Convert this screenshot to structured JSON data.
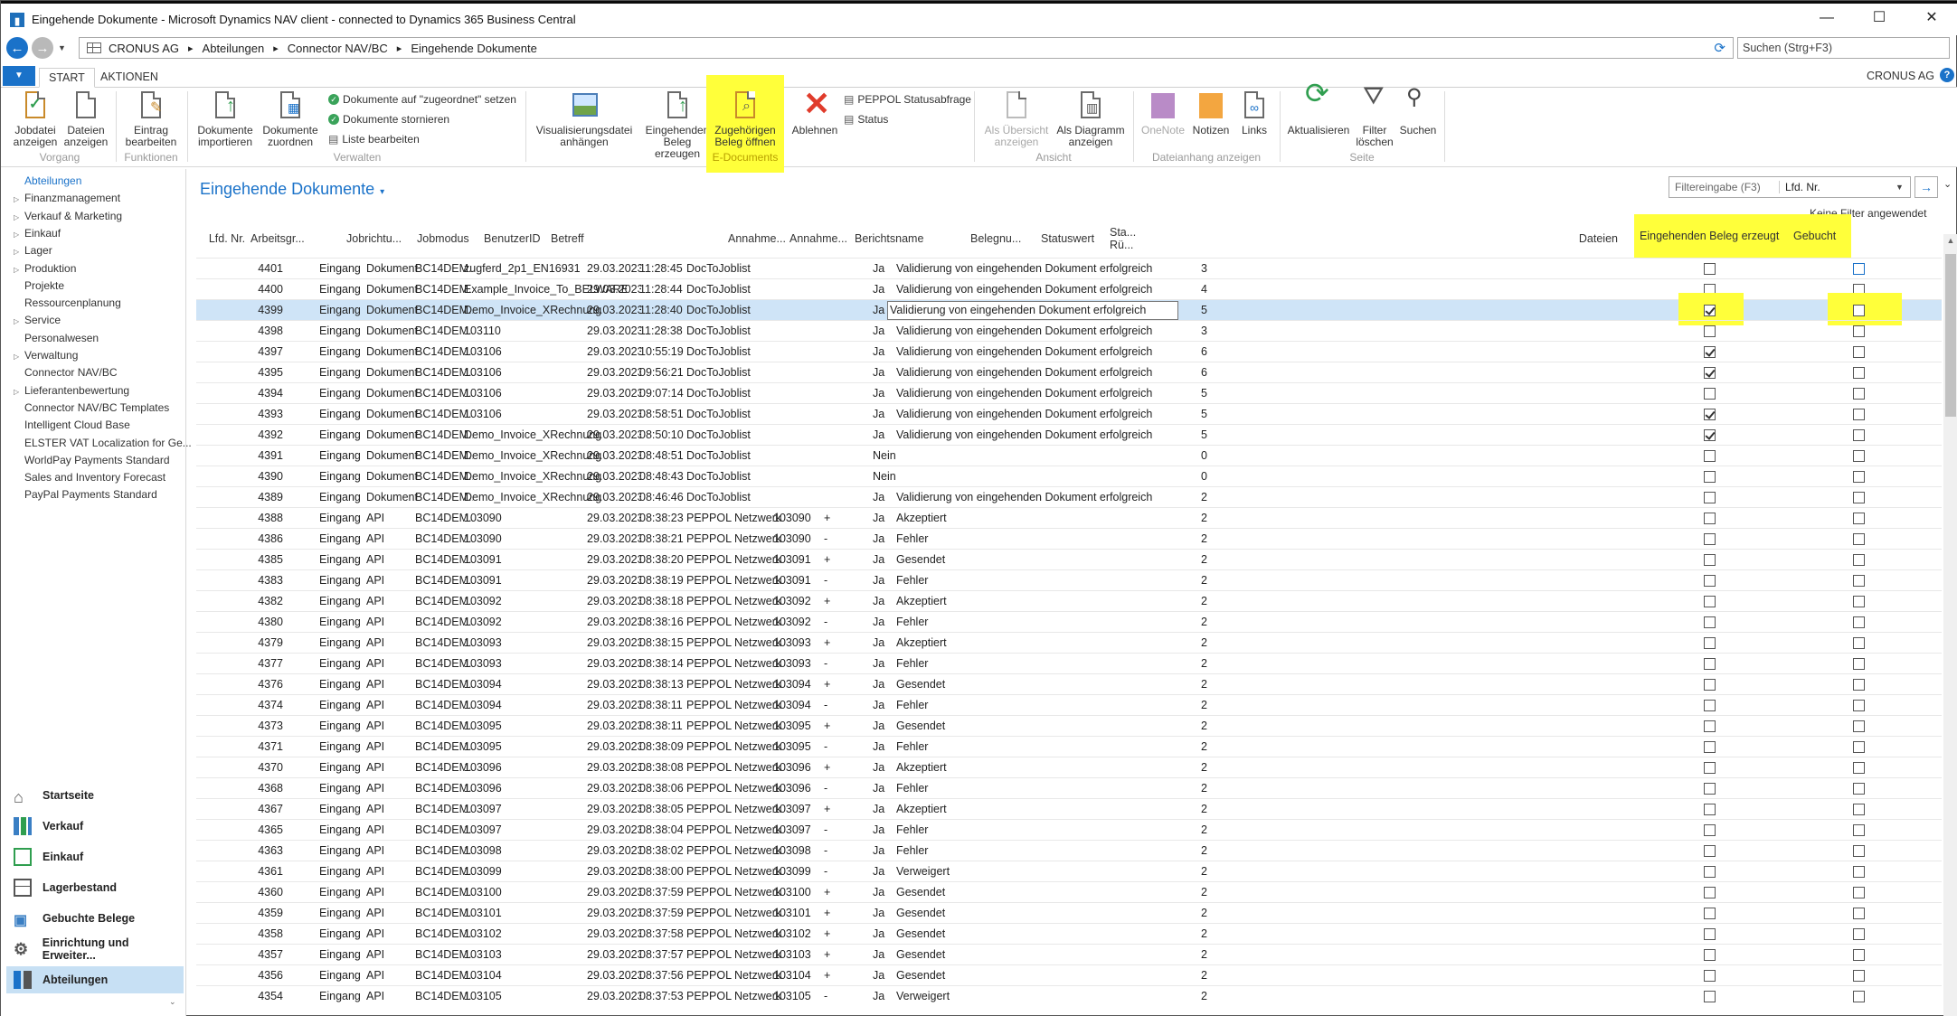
{
  "window": {
    "title": "Eingehende Dokumente - Microsoft Dynamics NAV client - connected to Dynamics 365 Business Central",
    "minimize": "—",
    "maximize": "☐",
    "close": "✕"
  },
  "nav": {
    "crumbs": [
      "CRONUS AG",
      "Abteilungen",
      "Connector NAV/BC",
      "Eingehende Dokumente"
    ],
    "search_placeholder": "Suchen (Strg+F3)"
  },
  "tabs": {
    "start": "START",
    "aktionen": "AKTIONEN"
  },
  "company": "CRONUS AG",
  "help": "?",
  "ribbon": {
    "buttons": {
      "jobdatei": "Jobdatei anzeigen",
      "dateien": "Dateien anzeigen",
      "eintrag": "Eintrag bearbeiten",
      "importieren": "Dokumente importieren",
      "zuordnen": "Dokumente zuordnen",
      "set_zugeordnet": "Dokumente auf \"zugeordnet\" setzen",
      "stornieren": "Dokumente stornieren",
      "liste": "Liste bearbeiten",
      "visualisierung": "Visualisierungsdatei anhängen",
      "beleg_erzeugen": "Eingehenden Beleg erzeugen",
      "beleg_oeffnen": "Zugehörigen Beleg öffnen",
      "ablehnen": "Ablehnen",
      "peppol": "PEPPOL Statusabfrage",
      "status": "Status",
      "als_uebersicht": "Als Übersicht anzeigen",
      "als_diagramm": "Als Diagramm anzeigen",
      "onenote": "OneNote",
      "notizen": "Notizen",
      "links": "Links",
      "aktualisieren": "Aktualisieren",
      "filter_loeschen": "Filter löschen",
      "suchen": "Suchen"
    },
    "groups": {
      "vorgang": "Vorgang",
      "funktionen": "Funktionen",
      "verwalten": "Verwalten",
      "edocuments": "E-Documents",
      "ansicht": "Ansicht",
      "dateianhang": "Dateianhang anzeigen",
      "seite": "Seite"
    }
  },
  "leftnav": {
    "items": [
      {
        "label": "Abteilungen",
        "tri": ""
      },
      {
        "label": "Finanzmanagement",
        "tri": "▷"
      },
      {
        "label": "Verkauf & Marketing",
        "tri": "▷"
      },
      {
        "label": "Einkauf",
        "tri": "▷"
      },
      {
        "label": "Lager",
        "tri": "▷"
      },
      {
        "label": "Produktion",
        "tri": "▷"
      },
      {
        "label": "Projekte",
        "tri": ""
      },
      {
        "label": "Ressourcenplanung",
        "tri": ""
      },
      {
        "label": "Service",
        "tri": "▷"
      },
      {
        "label": "Personalwesen",
        "tri": ""
      },
      {
        "label": "Verwaltung",
        "tri": "▷"
      },
      {
        "label": "Connector NAV/BC",
        "tri": ""
      },
      {
        "label": "Lieferantenbewertung",
        "tri": "▷"
      },
      {
        "label": "Connector NAV/BC Templates",
        "tri": ""
      },
      {
        "label": "Intelligent Cloud Base",
        "tri": ""
      },
      {
        "label": "ELSTER VAT Localization for Ge...",
        "tri": ""
      },
      {
        "label": "WorldPay Payments Standard",
        "tri": ""
      },
      {
        "label": "Sales and Inventory Forecast",
        "tri": ""
      },
      {
        "label": "PayPal Payments Standard",
        "tri": ""
      }
    ],
    "bottom": [
      {
        "label": "Startseite",
        "icon": "home-icon"
      },
      {
        "label": "Verkauf",
        "icon": "sales-icon"
      },
      {
        "label": "Einkauf",
        "icon": "purchase-icon"
      },
      {
        "label": "Lagerbestand",
        "icon": "inventory-icon"
      },
      {
        "label": "Gebuchte Belege",
        "icon": "posted-docs-icon"
      },
      {
        "label": "Einrichtung und Erweiter...",
        "icon": "settings-icon"
      },
      {
        "label": "Abteilungen",
        "icon": "departments-icon"
      }
    ]
  },
  "page": {
    "title": "Eingehende Dokumente",
    "title_caret": "▾",
    "filter_placeholder": "Filtereingabe (F3)",
    "filter_field": "Lfd. Nr.",
    "no_filter": "Keine Filter angewendet"
  },
  "columns": [
    "Lfd. Nr.",
    "Arbeitsgr...",
    "Jobrichtu...",
    "Jobmodus",
    "BenutzerID",
    "Betreff",
    "Annahme...",
    "Annahme...",
    "Berichtsname",
    "Belegnu...",
    "Statuswert",
    "Sta... Rü...",
    "",
    "Dateien",
    "Eingehenden Beleg erzeugt",
    "Gebucht"
  ],
  "rows": [
    {
      "nr": "4401",
      "job": "Eingang",
      "mode": "Dokument",
      "user": "BC14DEM...",
      "betreff": "zugferd_2p1_EN16931",
      "date": "29.03.2023",
      "time": "11:28:45",
      "report": "DocToJoblist",
      "beleg": "",
      "sw": "",
      "ru": "Ja",
      "msg": "Validierung von eingehenden Dokument erfolgreich",
      "files": "3",
      "created": false,
      "posted": false
    },
    {
      "nr": "4400",
      "job": "Eingang",
      "mode": "Dokument",
      "user": "BC14DEM...",
      "betreff": "Example_Invoice_To_BELWARE_G...",
      "date": "29.03.2023",
      "time": "11:28:44",
      "report": "DocToJoblist",
      "beleg": "",
      "sw": "",
      "ru": "Ja",
      "msg": "Validierung von eingehenden Dokument erfolgreich",
      "files": "4",
      "created": false,
      "posted": false
    },
    {
      "nr": "4399",
      "job": "Eingang",
      "mode": "Dokument",
      "user": "BC14DEM...",
      "betreff": "Demo_Invoice_XRechnung",
      "date": "29.03.2023",
      "time": "11:28:40",
      "report": "DocToJoblist",
      "beleg": "",
      "sw": "",
      "ru": "Ja",
      "msg": "Validierung von eingehenden Dokument erfolgreich",
      "files": "5",
      "created": true,
      "posted": false
    },
    {
      "nr": "4398",
      "job": "Eingang",
      "mode": "Dokument",
      "user": "BC14DEM...",
      "betreff": "103110",
      "date": "29.03.2023",
      "time": "11:28:38",
      "report": "DocToJoblist",
      "beleg": "",
      "sw": "",
      "ru": "Ja",
      "msg": "Validierung von eingehenden Dokument erfolgreich",
      "files": "3",
      "created": false,
      "posted": false
    },
    {
      "nr": "4397",
      "job": "Eingang",
      "mode": "Dokument",
      "user": "BC14DEM...",
      "betreff": "103106",
      "date": "29.03.2023",
      "time": "10:55:19",
      "report": "DocToJoblist",
      "beleg": "",
      "sw": "",
      "ru": "Ja",
      "msg": "Validierung von eingehenden Dokument erfolgreich",
      "files": "6",
      "created": true,
      "posted": false
    },
    {
      "nr": "4395",
      "job": "Eingang",
      "mode": "Dokument",
      "user": "BC14DEM...",
      "betreff": "103106",
      "date": "29.03.2023",
      "time": "09:56:21",
      "report": "DocToJoblist",
      "beleg": "",
      "sw": "",
      "ru": "Ja",
      "msg": "Validierung von eingehenden Dokument erfolgreich",
      "files": "6",
      "created": true,
      "posted": false
    },
    {
      "nr": "4394",
      "job": "Eingang",
      "mode": "Dokument",
      "user": "BC14DEM...",
      "betreff": "103106",
      "date": "29.03.2023",
      "time": "09:07:14",
      "report": "DocToJoblist",
      "beleg": "",
      "sw": "",
      "ru": "Ja",
      "msg": "Validierung von eingehenden Dokument erfolgreich",
      "files": "5",
      "created": false,
      "posted": false
    },
    {
      "nr": "4393",
      "job": "Eingang",
      "mode": "Dokument",
      "user": "BC14DEM...",
      "betreff": "103106",
      "date": "29.03.2023",
      "time": "08:58:51",
      "report": "DocToJoblist",
      "beleg": "",
      "sw": "",
      "ru": "Ja",
      "msg": "Validierung von eingehenden Dokument erfolgreich",
      "files": "5",
      "created": true,
      "posted": false
    },
    {
      "nr": "4392",
      "job": "Eingang",
      "mode": "Dokument",
      "user": "BC14DEM...",
      "betreff": "Demo_Invoice_XRechnung",
      "date": "29.03.2023",
      "time": "08:50:10",
      "report": "DocToJoblist",
      "beleg": "",
      "sw": "",
      "ru": "Ja",
      "msg": "Validierung von eingehenden Dokument erfolgreich",
      "files": "5",
      "created": true,
      "posted": false
    },
    {
      "nr": "4391",
      "job": "Eingang",
      "mode": "Dokument",
      "user": "BC14DEM...",
      "betreff": "Demo_Invoice_XRechnung",
      "date": "29.03.2023",
      "time": "08:48:51",
      "report": "DocToJoblist",
      "beleg": "",
      "sw": "",
      "ru": "Nein",
      "msg": "",
      "files": "0",
      "created": false,
      "posted": false
    },
    {
      "nr": "4390",
      "job": "Eingang",
      "mode": "Dokument",
      "user": "BC14DEM...",
      "betreff": "Demo_Invoice_XRechnung",
      "date": "29.03.2023",
      "time": "08:48:43",
      "report": "DocToJoblist",
      "beleg": "",
      "sw": "",
      "ru": "Nein",
      "msg": "",
      "files": "0",
      "created": false,
      "posted": false
    },
    {
      "nr": "4389",
      "job": "Eingang",
      "mode": "Dokument",
      "user": "BC14DEM...",
      "betreff": "Demo_Invoice_XRechnung",
      "date": "29.03.2023",
      "time": "08:46:46",
      "report": "DocToJoblist",
      "beleg": "",
      "sw": "",
      "ru": "Ja",
      "msg": "Validierung von eingehenden Dokument erfolgreich",
      "files": "2",
      "created": false,
      "posted": false
    },
    {
      "nr": "4388",
      "job": "Eingang",
      "mode": "API",
      "user": "BC14DEM...",
      "betreff": "103090",
      "date": "29.03.2023",
      "time": "08:38:23",
      "report": "PEPPOL Netzwerk",
      "beleg": "103090",
      "sw": "+",
      "ru": "Ja",
      "msg": "Akzeptiert",
      "files": "2",
      "created": false,
      "posted": false
    },
    {
      "nr": "4386",
      "job": "Eingang",
      "mode": "API",
      "user": "BC14DEM...",
      "betreff": "103090",
      "date": "29.03.2023",
      "time": "08:38:21",
      "report": "PEPPOL Netzwerk",
      "beleg": "103090",
      "sw": "-",
      "ru": "Ja",
      "msg": "Fehler",
      "files": "2",
      "created": false,
      "posted": false
    },
    {
      "nr": "4385",
      "job": "Eingang",
      "mode": "API",
      "user": "BC14DEM...",
      "betreff": "103091",
      "date": "29.03.2023",
      "time": "08:38:20",
      "report": "PEPPOL Netzwerk",
      "beleg": "103091",
      "sw": "+",
      "ru": "Ja",
      "msg": "Gesendet",
      "files": "2",
      "created": false,
      "posted": false
    },
    {
      "nr": "4383",
      "job": "Eingang",
      "mode": "API",
      "user": "BC14DEM...",
      "betreff": "103091",
      "date": "29.03.2023",
      "time": "08:38:19",
      "report": "PEPPOL Netzwerk",
      "beleg": "103091",
      "sw": "-",
      "ru": "Ja",
      "msg": "Fehler",
      "files": "2",
      "created": false,
      "posted": false
    },
    {
      "nr": "4382",
      "job": "Eingang",
      "mode": "API",
      "user": "BC14DEM...",
      "betreff": "103092",
      "date": "29.03.2023",
      "time": "08:38:18",
      "report": "PEPPOL Netzwerk",
      "beleg": "103092",
      "sw": "+",
      "ru": "Ja",
      "msg": "Akzeptiert",
      "files": "2",
      "created": false,
      "posted": false
    },
    {
      "nr": "4380",
      "job": "Eingang",
      "mode": "API",
      "user": "BC14DEM...",
      "betreff": "103092",
      "date": "29.03.2023",
      "time": "08:38:16",
      "report": "PEPPOL Netzwerk",
      "beleg": "103092",
      "sw": "-",
      "ru": "Ja",
      "msg": "Fehler",
      "files": "2",
      "created": false,
      "posted": false
    },
    {
      "nr": "4379",
      "job": "Eingang",
      "mode": "API",
      "user": "BC14DEM...",
      "betreff": "103093",
      "date": "29.03.2023",
      "time": "08:38:15",
      "report": "PEPPOL Netzwerk",
      "beleg": "103093",
      "sw": "+",
      "ru": "Ja",
      "msg": "Akzeptiert",
      "files": "2",
      "created": false,
      "posted": false
    },
    {
      "nr": "4377",
      "job": "Eingang",
      "mode": "API",
      "user": "BC14DEM...",
      "betreff": "103093",
      "date": "29.03.2023",
      "time": "08:38:14",
      "report": "PEPPOL Netzwerk",
      "beleg": "103093",
      "sw": "-",
      "ru": "Ja",
      "msg": "Fehler",
      "files": "2",
      "created": false,
      "posted": false
    },
    {
      "nr": "4376",
      "job": "Eingang",
      "mode": "API",
      "user": "BC14DEM...",
      "betreff": "103094",
      "date": "29.03.2023",
      "time": "08:38:13",
      "report": "PEPPOL Netzwerk",
      "beleg": "103094",
      "sw": "+",
      "ru": "Ja",
      "msg": "Gesendet",
      "files": "2",
      "created": false,
      "posted": false
    },
    {
      "nr": "4374",
      "job": "Eingang",
      "mode": "API",
      "user": "BC14DEM...",
      "betreff": "103094",
      "date": "29.03.2023",
      "time": "08:38:11",
      "report": "PEPPOL Netzwerk",
      "beleg": "103094",
      "sw": "-",
      "ru": "Ja",
      "msg": "Fehler",
      "files": "2",
      "created": false,
      "posted": false
    },
    {
      "nr": "4373",
      "job": "Eingang",
      "mode": "API",
      "user": "BC14DEM...",
      "betreff": "103095",
      "date": "29.03.2023",
      "time": "08:38:11",
      "report": "PEPPOL Netzwerk",
      "beleg": "103095",
      "sw": "+",
      "ru": "Ja",
      "msg": "Gesendet",
      "files": "2",
      "created": false,
      "posted": false
    },
    {
      "nr": "4371",
      "job": "Eingang",
      "mode": "API",
      "user": "BC14DEM...",
      "betreff": "103095",
      "date": "29.03.2023",
      "time": "08:38:09",
      "report": "PEPPOL Netzwerk",
      "beleg": "103095",
      "sw": "-",
      "ru": "Ja",
      "msg": "Fehler",
      "files": "2",
      "created": false,
      "posted": false
    },
    {
      "nr": "4370",
      "job": "Eingang",
      "mode": "API",
      "user": "BC14DEM...",
      "betreff": "103096",
      "date": "29.03.2023",
      "time": "08:38:08",
      "report": "PEPPOL Netzwerk",
      "beleg": "103096",
      "sw": "+",
      "ru": "Ja",
      "msg": "Akzeptiert",
      "files": "2",
      "created": false,
      "posted": false
    },
    {
      "nr": "4368",
      "job": "Eingang",
      "mode": "API",
      "user": "BC14DEM...",
      "betreff": "103096",
      "date": "29.03.2023",
      "time": "08:38:06",
      "report": "PEPPOL Netzwerk",
      "beleg": "103096",
      "sw": "-",
      "ru": "Ja",
      "msg": "Fehler",
      "files": "2",
      "created": false,
      "posted": false
    },
    {
      "nr": "4367",
      "job": "Eingang",
      "mode": "API",
      "user": "BC14DEM...",
      "betreff": "103097",
      "date": "29.03.2023",
      "time": "08:38:05",
      "report": "PEPPOL Netzwerk",
      "beleg": "103097",
      "sw": "+",
      "ru": "Ja",
      "msg": "Akzeptiert",
      "files": "2",
      "created": false,
      "posted": false
    },
    {
      "nr": "4365",
      "job": "Eingang",
      "mode": "API",
      "user": "BC14DEM...",
      "betreff": "103097",
      "date": "29.03.2023",
      "time": "08:38:04",
      "report": "PEPPOL Netzwerk",
      "beleg": "103097",
      "sw": "-",
      "ru": "Ja",
      "msg": "Fehler",
      "files": "2",
      "created": false,
      "posted": false
    },
    {
      "nr": "4363",
      "job": "Eingang",
      "mode": "API",
      "user": "BC14DEM...",
      "betreff": "103098",
      "date": "29.03.2023",
      "time": "08:38:02",
      "report": "PEPPOL Netzwerk",
      "beleg": "103098",
      "sw": "-",
      "ru": "Ja",
      "msg": "Fehler",
      "files": "2",
      "created": false,
      "posted": false
    },
    {
      "nr": "4361",
      "job": "Eingang",
      "mode": "API",
      "user": "BC14DEM...",
      "betreff": "103099",
      "date": "29.03.2023",
      "time": "08:38:00",
      "report": "PEPPOL Netzwerk",
      "beleg": "103099",
      "sw": "-",
      "ru": "Ja",
      "msg": "Verweigert",
      "files": "2",
      "created": false,
      "posted": false
    },
    {
      "nr": "4360",
      "job": "Eingang",
      "mode": "API",
      "user": "BC14DEM...",
      "betreff": "103100",
      "date": "29.03.2023",
      "time": "08:37:59",
      "report": "PEPPOL Netzwerk",
      "beleg": "103100",
      "sw": "+",
      "ru": "Ja",
      "msg": "Gesendet",
      "files": "2",
      "created": false,
      "posted": false
    },
    {
      "nr": "4359",
      "job": "Eingang",
      "mode": "API",
      "user": "BC14DEM...",
      "betreff": "103101",
      "date": "29.03.2023",
      "time": "08:37:59",
      "report": "PEPPOL Netzwerk",
      "beleg": "103101",
      "sw": "+",
      "ru": "Ja",
      "msg": "Gesendet",
      "files": "2",
      "created": false,
      "posted": false
    },
    {
      "nr": "4358",
      "job": "Eingang",
      "mode": "API",
      "user": "BC14DEM...",
      "betreff": "103102",
      "date": "29.03.2023",
      "time": "08:37:58",
      "report": "PEPPOL Netzwerk",
      "beleg": "103102",
      "sw": "+",
      "ru": "Ja",
      "msg": "Gesendet",
      "files": "2",
      "created": false,
      "posted": false
    },
    {
      "nr": "4357",
      "job": "Eingang",
      "mode": "API",
      "user": "BC14DEM...",
      "betreff": "103103",
      "date": "29.03.2023",
      "time": "08:37:57",
      "report": "PEPPOL Netzwerk",
      "beleg": "103103",
      "sw": "+",
      "ru": "Ja",
      "msg": "Gesendet",
      "files": "2",
      "created": false,
      "posted": false
    },
    {
      "nr": "4356",
      "job": "Eingang",
      "mode": "API",
      "user": "BC14DEM...",
      "betreff": "103104",
      "date": "29.03.2023",
      "time": "08:37:56",
      "report": "PEPPOL Netzwerk",
      "beleg": "103104",
      "sw": "+",
      "ru": "Ja",
      "msg": "Gesendet",
      "files": "2",
      "created": false,
      "posted": false
    },
    {
      "nr": "4354",
      "job": "Eingang",
      "mode": "API",
      "user": "BC14DEM...",
      "betreff": "103105",
      "date": "29.03.2023",
      "time": "08:37:53",
      "report": "PEPPOL Netzwerk",
      "beleg": "103105",
      "sw": "-",
      "ru": "Ja",
      "msg": "Verweigert",
      "files": "2",
      "created": false,
      "posted": false
    }
  ],
  "selected_row": "4399",
  "colors": {
    "accent": "#1a72c9",
    "highlight": "#ffff3a",
    "selected_row": "#cfe4f7"
  }
}
